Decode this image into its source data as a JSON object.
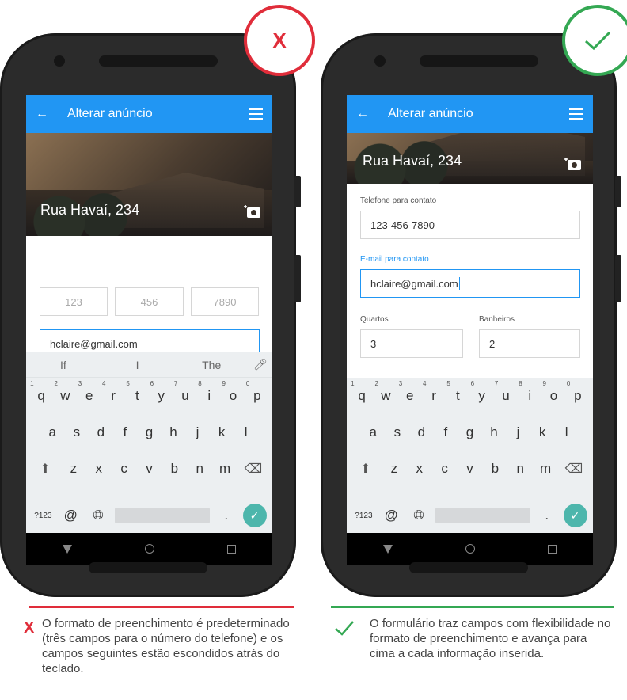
{
  "badges": {
    "bad_symbol": "X"
  },
  "colors": {
    "appbar": "#2196f3",
    "bad": "#e02d3a",
    "good": "#34a853",
    "enter_key": "#4db6ac",
    "focus": "#2196f3"
  },
  "phone_left": {
    "appbar": {
      "back": "←",
      "title": "Alterar anúncio"
    },
    "hero": {
      "address": "Rua Havaí, 234"
    },
    "phone_fields": [
      "123",
      "456",
      "7890"
    ],
    "email_value": "hclaire@gmail.com",
    "suggestions": [
      "If",
      "I",
      "The"
    ]
  },
  "phone_right": {
    "appbar": {
      "back": "←",
      "title": "Alterar anúncio"
    },
    "hero": {
      "address": "Rua Havaí, 234"
    },
    "phone_label": "Telefone para contato",
    "phone_value": "123-456-7890",
    "email_label": "E-mail para contato",
    "email_value": "hclaire@gmail.com",
    "rooms_label": "Quartos",
    "rooms_value": "3",
    "baths_label": "Banheiros",
    "baths_value": "2"
  },
  "keyboard": {
    "row1": [
      {
        "k": "q",
        "n": "1"
      },
      {
        "k": "w",
        "n": "2"
      },
      {
        "k": "e",
        "n": "3"
      },
      {
        "k": "r",
        "n": "4"
      },
      {
        "k": "t",
        "n": "5"
      },
      {
        "k": "y",
        "n": "6"
      },
      {
        "k": "u",
        "n": "7"
      },
      {
        "k": "i",
        "n": "8"
      },
      {
        "k": "o",
        "n": "9"
      },
      {
        "k": "p",
        "n": "0"
      }
    ],
    "row2": [
      "a",
      "s",
      "d",
      "f",
      "g",
      "h",
      "j",
      "k",
      "l"
    ],
    "row3": [
      "z",
      "x",
      "c",
      "v",
      "b",
      "n",
      "m"
    ],
    "symbols": "?123",
    "at": "@",
    "period": "."
  },
  "captions": {
    "bad": "O formato de preenchimento é predeterminado (três campos para o número do telefone) e os campos seguintes estão escondidos atrás do teclado.",
    "good": "O formulário traz campos com flexibilidade no formato de preenchimento e avança para cima a cada informação inserida.",
    "bad_icon": "X"
  }
}
